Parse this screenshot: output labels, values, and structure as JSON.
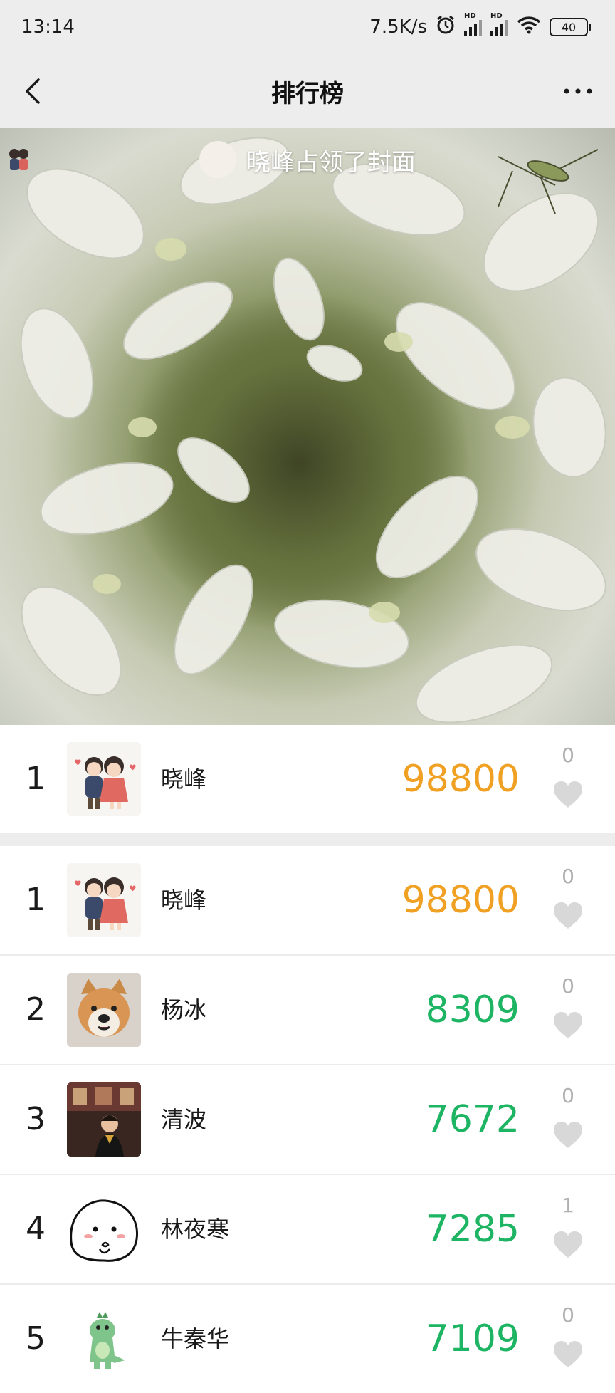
{
  "status_bar": {
    "time": "13:14",
    "net_speed": "7.5K/s",
    "signal_label": "HD",
    "battery": "40",
    "icons": [
      "alarm-icon",
      "signal-icon",
      "signal-icon",
      "wifi-icon",
      "battery-icon"
    ]
  },
  "nav": {
    "title": "排行榜",
    "back_icon": "back-arrow-icon",
    "more_icon": "more-dots-icon"
  },
  "cover": {
    "caption": "晓峰占领了封面"
  },
  "colors": {
    "top_score": "#f0a023",
    "score": "#1db463",
    "likes": "#b0b0b0",
    "background_bar": "#ededed"
  },
  "my_entry": {
    "rank": "1",
    "name": "晓峰",
    "score": "98800",
    "likes": "0",
    "avatar": "couple-cartoon"
  },
  "leaderboard": [
    {
      "rank": "1",
      "name": "晓峰",
      "score": "98800",
      "likes": "0",
      "avatar": "couple-cartoon"
    },
    {
      "rank": "2",
      "name": "杨冰",
      "score": "8309",
      "likes": "0",
      "avatar": "shiba-dog-photo"
    },
    {
      "rank": "3",
      "name": "清波",
      "score": "7672",
      "likes": "0",
      "avatar": "graduation-photo"
    },
    {
      "rank": "4",
      "name": "林夜寒",
      "score": "7285",
      "likes": "1",
      "avatar": "cartoon-face"
    },
    {
      "rank": "5",
      "name": "牛秦华",
      "score": "7109",
      "likes": "0",
      "avatar": "green-dinosaur"
    }
  ]
}
